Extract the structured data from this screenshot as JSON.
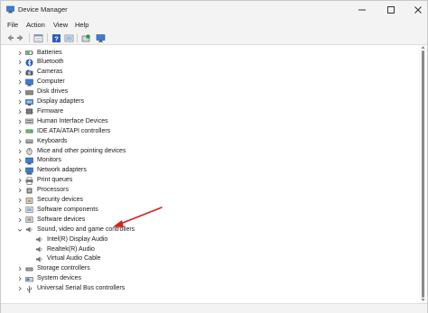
{
  "window": {
    "title": "Device Manager",
    "controls": {
      "minimize_icon": "minimize-icon",
      "maximize_icon": "maximize-icon",
      "close_icon": "close-icon"
    }
  },
  "menu": {
    "items": [
      "File",
      "Action",
      "View",
      "Help"
    ]
  },
  "toolbar": {
    "buttons": [
      "back-icon",
      "forward-icon",
      "properties-icon",
      "help-icon",
      "update-driver-icon",
      "scan-hardware-icon",
      "monitor-icon"
    ]
  },
  "tree": {
    "items": [
      {
        "label": "Batteries",
        "icon": "battery-icon",
        "expanded": false,
        "level": 0
      },
      {
        "label": "Bluetooth",
        "icon": "bluetooth-icon",
        "expanded": false,
        "level": 0
      },
      {
        "label": "Cameras",
        "icon": "camera-icon",
        "expanded": false,
        "level": 0
      },
      {
        "label": "Computer",
        "icon": "computer-icon",
        "expanded": false,
        "level": 0
      },
      {
        "label": "Disk drives",
        "icon": "disk-drive-icon",
        "expanded": false,
        "level": 0
      },
      {
        "label": "Display adapters",
        "icon": "display-adapter-icon",
        "expanded": false,
        "level": 0
      },
      {
        "label": "Firmware",
        "icon": "firmware-icon",
        "expanded": false,
        "level": 0
      },
      {
        "label": "Human Interface Devices",
        "icon": "hid-icon",
        "expanded": false,
        "level": 0
      },
      {
        "label": "IDE ATA/ATAPI controllers",
        "icon": "ide-controller-icon",
        "expanded": false,
        "level": 0
      },
      {
        "label": "Keyboards",
        "icon": "keyboard-icon",
        "expanded": false,
        "level": 0
      },
      {
        "label": "Mice and other pointing devices",
        "icon": "mouse-icon",
        "expanded": false,
        "level": 0
      },
      {
        "label": "Monitors",
        "icon": "monitor-icon",
        "expanded": false,
        "level": 0
      },
      {
        "label": "Network adapters",
        "icon": "network-adapter-icon",
        "expanded": false,
        "level": 0
      },
      {
        "label": "Print queues",
        "icon": "printer-icon",
        "expanded": false,
        "level": 0
      },
      {
        "label": "Processors",
        "icon": "processor-icon",
        "expanded": false,
        "level": 0
      },
      {
        "label": "Security devices",
        "icon": "security-device-icon",
        "expanded": false,
        "level": 0
      },
      {
        "label": "Software components",
        "icon": "software-component-icon",
        "expanded": false,
        "level": 0
      },
      {
        "label": "Software devices",
        "icon": "software-device-icon",
        "expanded": false,
        "level": 0
      },
      {
        "label": "Sound, video and game controllers",
        "icon": "speaker-icon",
        "expanded": true,
        "level": 0
      },
      {
        "label": "Intel(R) Display Audio",
        "icon": "speaker-icon",
        "expanded": null,
        "level": 1
      },
      {
        "label": "Realtek(R) Audio",
        "icon": "speaker-icon",
        "expanded": null,
        "level": 1
      },
      {
        "label": "Virtual Audio Cable",
        "icon": "speaker-icon",
        "expanded": null,
        "level": 1
      },
      {
        "label": "Storage controllers",
        "icon": "storage-controller-icon",
        "expanded": false,
        "level": 0
      },
      {
        "label": "System devices",
        "icon": "system-device-icon",
        "expanded": false,
        "level": 0
      },
      {
        "label": "Universal Serial Bus controllers",
        "icon": "usb-icon",
        "expanded": false,
        "level": 0
      }
    ]
  },
  "annotation": {
    "arrow_color": "#d62020",
    "points_to": "Software devices"
  },
  "colors": {
    "accent": "#1f6fd0",
    "chrome": "#f3f3f3",
    "arrow": "#d62020"
  }
}
